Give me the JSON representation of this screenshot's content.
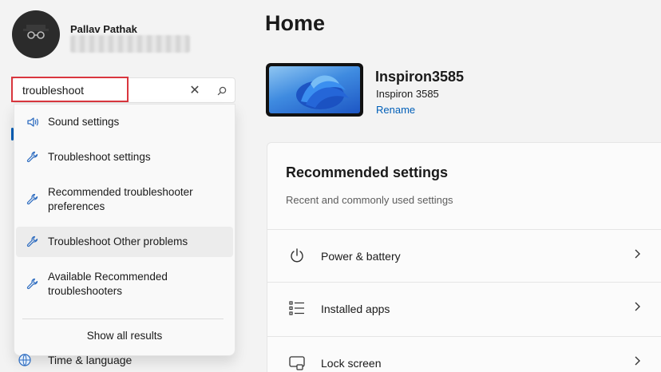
{
  "user": {
    "name": "Pallav Pathak"
  },
  "search": {
    "value": "troubleshoot",
    "clear_icon": "close-icon",
    "search_icon": "search-icon",
    "results": [
      {
        "label": "Sound settings",
        "icon": "speaker-icon"
      },
      {
        "label": "Troubleshoot settings",
        "icon": "wrench-icon"
      },
      {
        "label": "Recommended troubleshooter preferences",
        "icon": "wrench-icon"
      },
      {
        "label": "Troubleshoot Other problems",
        "icon": "wrench-icon",
        "selected": true
      },
      {
        "label": "Available Recommended troubleshooters",
        "icon": "wrench-icon"
      }
    ],
    "show_all_label": "Show all results"
  },
  "nav": {
    "time_language_label": "Time & language"
  },
  "main": {
    "title": "Home",
    "device": {
      "name": "Inspiron3585",
      "model": "Inspiron 3585",
      "rename_label": "Rename"
    },
    "recommended": {
      "title": "Recommended settings",
      "subtitle": "Recent and commonly used settings",
      "items": [
        {
          "label": "Power & battery",
          "icon": "power-icon"
        },
        {
          "label": "Installed apps",
          "icon": "apps-list-icon"
        },
        {
          "label": "Lock screen",
          "icon": "lock-screen-icon"
        }
      ]
    }
  },
  "colors": {
    "accent": "#005fb8",
    "highlight": "#d9363e",
    "background": "#f3f3f3"
  }
}
